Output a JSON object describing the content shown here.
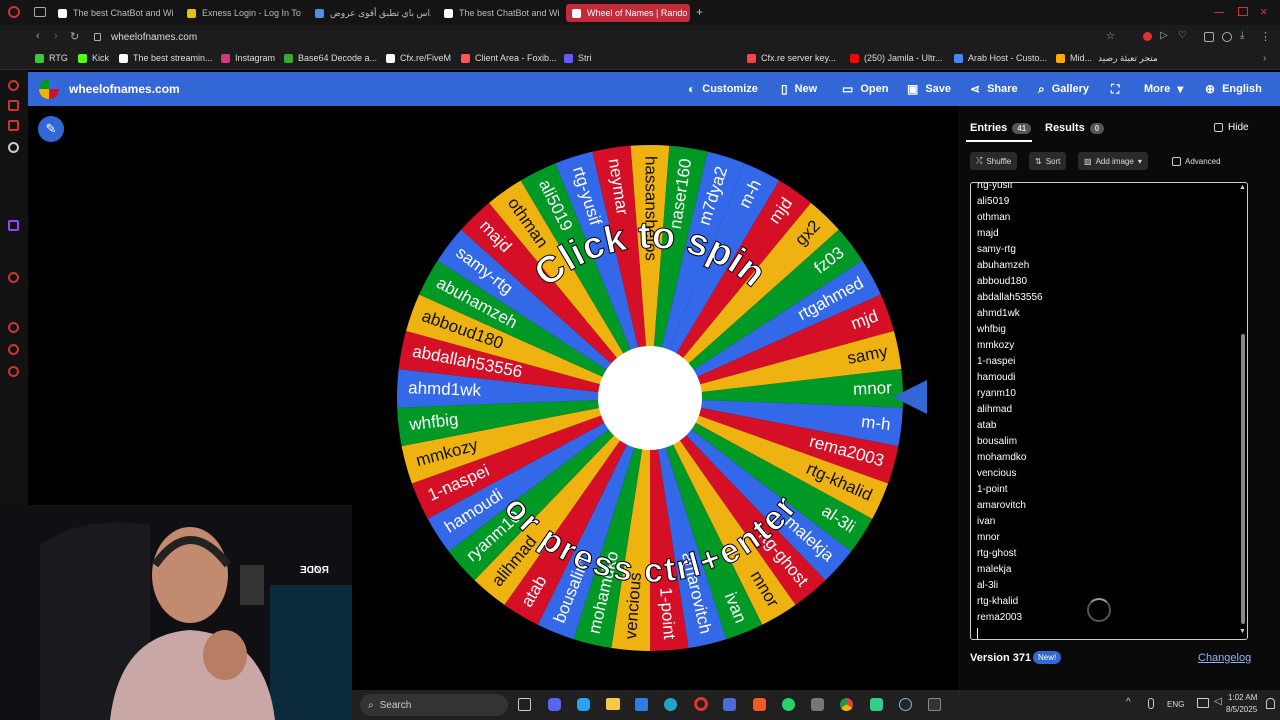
{
  "browser": {
    "tabs": [
      {
        "title": "The best ChatBot and Wi",
        "active": false
      },
      {
        "title": "Exness Login - Log In To",
        "active": false
      },
      {
        "title": "ميداس باي تطبق أقوى عروض",
        "active": false
      },
      {
        "title": "The best ChatBot and Wi",
        "active": false
      },
      {
        "title": "Wheel of Names | Rando",
        "active": true
      }
    ],
    "new_tab": "+",
    "url": "wheelofnames.com",
    "bookmarks": [
      "RTG",
      "Kick",
      "The best streamin...",
      "Instagram",
      "Base64 Decode a...",
      "Cfx.re/FiveM",
      "Client Area - Foxib...",
      "Stri",
      "Cfx.re server key...",
      "(250) Jamila - Ultr...",
      "Arab Host - Custo...",
      "Mid...",
      "متجر تعبئة رصيد"
    ]
  },
  "app": {
    "brand": "wheelofnames.com",
    "menu": {
      "customize": "Customize",
      "new": "New",
      "open": "Open",
      "save": "Save",
      "share": "Share",
      "gallery": "Gallery",
      "more": "More",
      "language": "English"
    }
  },
  "wheel": {
    "top_text": "Click to spin",
    "bottom_text": "or press ctrl+enter",
    "colors": [
      "#3369e8",
      "#d50f25",
      "#eeb211",
      "#009925"
    ],
    "labels": [
      "m-h",
      "mjd",
      "gx2",
      "fz03",
      "rtgahmed",
      "mjd",
      "samy",
      "mnor",
      "m-h",
      "rema2003",
      "rtg-khalid",
      "al-3li",
      "malekja",
      "rtg-ghost",
      "mnor",
      "ivan",
      "amarovitch",
      "1-point",
      "vencious",
      "mohamdko",
      "bousalim",
      "atab",
      "alihmad",
      "ryanm10",
      "hamoudi",
      "1-naspei",
      "mmkozy",
      "whfbig",
      "ahmd1wk",
      "abdallah53556",
      "abboud180",
      "abuhamzeh",
      "samy-rtg",
      "majd",
      "othman",
      "ali5019",
      "rtg-yusif",
      "neymar",
      "hassanshetos",
      "naser160",
      "m7dya2"
    ]
  },
  "panel": {
    "entries_tab": "Entries",
    "entries_count": "41",
    "results_tab": "Results",
    "results_count": "0",
    "hide": "Hide",
    "shuffle": "Shuffle",
    "sort": "Sort",
    "add_image": "Add image",
    "advanced": "Advanced",
    "entries": [
      "rtg-yusif",
      "ali5019",
      "othman",
      "majd",
      "samy-rtg",
      "abuhamzeh",
      "abboud180",
      "abdallah53556",
      "ahmd1wk",
      "whfbig",
      "mmkozy",
      "1-naspei",
      "hamoudi",
      "ryanm10",
      "alihmad",
      "atab",
      "bousalim",
      "mohamdko",
      "vencious",
      "1-point",
      "amarovitch",
      "ivan",
      "mnor",
      "rtg-ghost",
      "malekja",
      "al-3li",
      "rtg-khalid",
      "rema2003"
    ],
    "version": "Version 371",
    "new_badge": "New!",
    "changelog": "Changelog"
  },
  "taskbar": {
    "search": "Search",
    "lang": "ENG",
    "time": "1:02 AM",
    "date": "8/5/2025"
  },
  "webcam": {
    "mic_brand": "RØDE"
  }
}
